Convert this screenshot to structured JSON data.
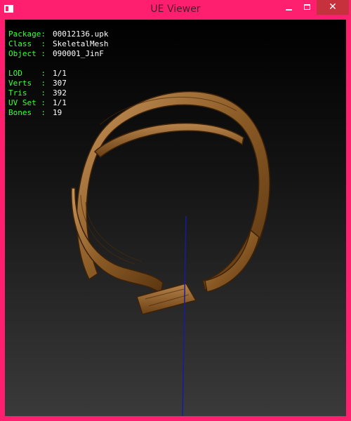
{
  "window": {
    "title": "UE Viewer",
    "minimize_glyph": "",
    "maximize_glyph": "",
    "close_glyph": "✕",
    "icons": [
      "app-icon",
      "minimize-icon",
      "maximize-icon",
      "close-icon"
    ]
  },
  "info": {
    "package_label": "Package:",
    "package_value": "00012136.upk",
    "class_label": "Class  :",
    "class_value": "SkeletalMesh",
    "object_label": "Object :",
    "object_value": "090001_JinF",
    "lod_label": "LOD    :",
    "lod_value": "1/1",
    "verts_label": "Verts  :",
    "verts_value": "307",
    "tris_label": "Tris   :",
    "tris_value": "392",
    "uvset_label": "UV Set :",
    "uvset_value": "1/1",
    "bones_label": "Bones  :",
    "bones_value": "19"
  },
  "colors": {
    "frame": "#ff1f6e",
    "close_button": "#c7303d",
    "label_green": "#3cff3c",
    "value_white": "#ffffff",
    "axis_blue": "#1a1aa0",
    "wood": "#8a5a25"
  }
}
